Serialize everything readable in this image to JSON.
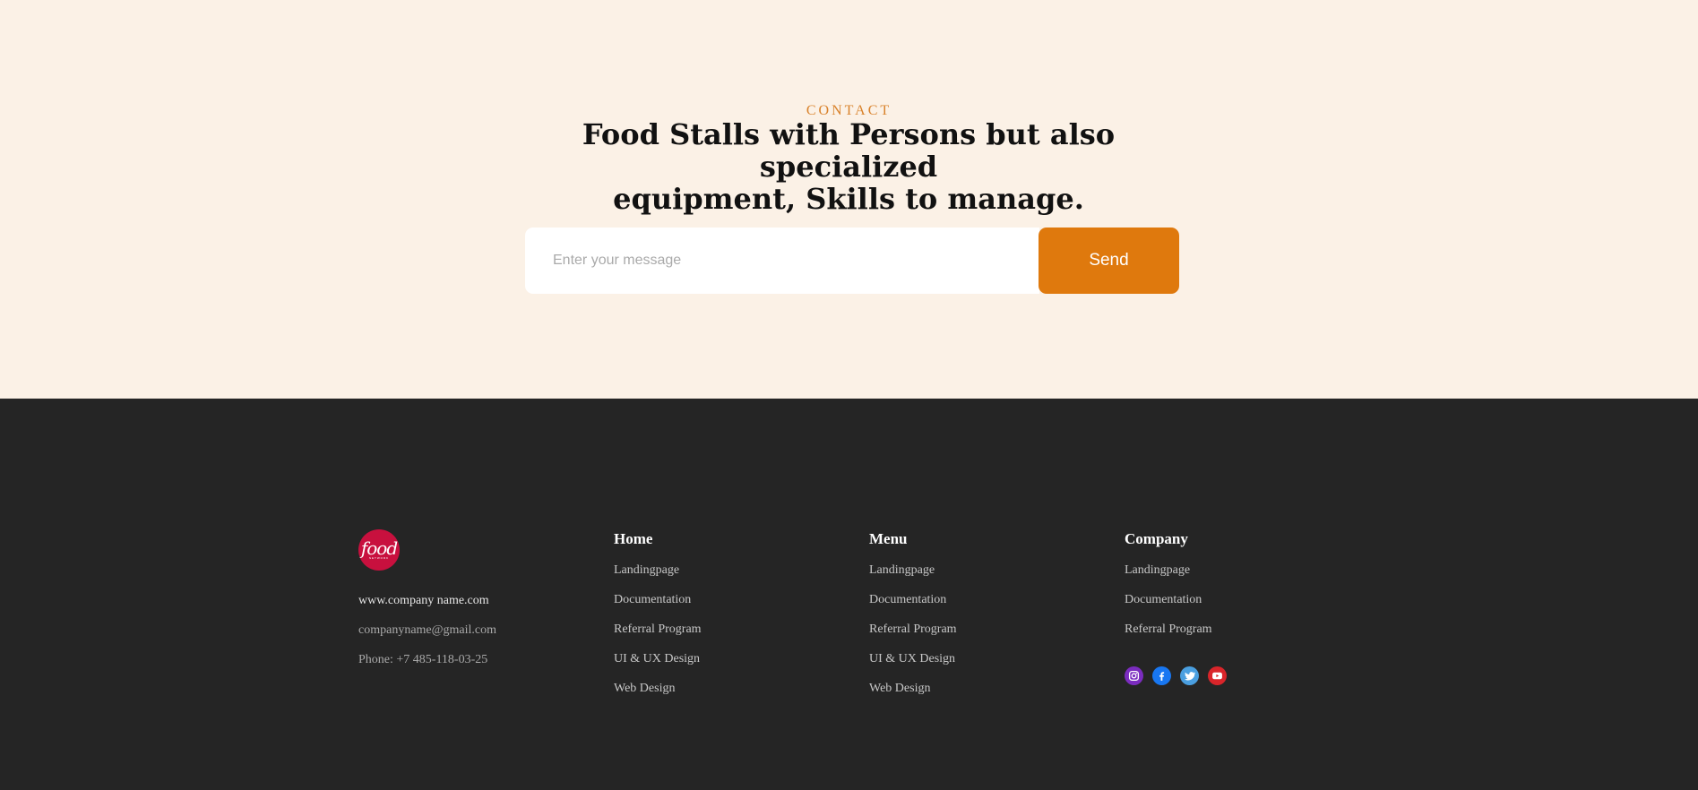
{
  "contact": {
    "eyebrow": "CONTACT",
    "headline_line1": "Food Stalls with Persons but also specialized",
    "headline_line2": "equipment, Skills to manage.",
    "input_placeholder": "Enter your message",
    "send_label": "Send"
  },
  "footer": {
    "logo": {
      "word": "food",
      "sub": "NETWORK"
    },
    "website": "www.company name.com",
    "email": "companyname@gmail.com",
    "phone": "Phone: +7 485-118-03-25",
    "columns": [
      {
        "title": "Home",
        "links": [
          "Landingpage",
          "Documentation",
          "Referral Program",
          "UI & UX Design",
          "Web Design"
        ]
      },
      {
        "title": "Menu",
        "links": [
          "Landingpage",
          "Documentation",
          "Referral Program",
          "UI & UX Design",
          "Web Design"
        ]
      },
      {
        "title": "Company",
        "links": [
          "Landingpage",
          "Documentation",
          "Referral Program"
        ]
      }
    ],
    "socials": [
      {
        "icon": "instagram-icon",
        "color": "#7b2cbf"
      },
      {
        "icon": "facebook-icon",
        "color": "#1877f2"
      },
      {
        "icon": "twitter-icon",
        "color": "#4a9fe0"
      },
      {
        "icon": "youtube-icon",
        "color": "#d9252a"
      }
    ]
  },
  "colors": {
    "accent": "#df790d",
    "contact_bg": "#fbf1e6",
    "footer_bg": "#252525"
  }
}
